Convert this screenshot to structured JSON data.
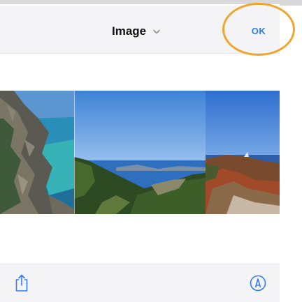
{
  "header": {
    "title": "Image",
    "ok_label": "OK"
  },
  "icons": {
    "title_chevron": "chevron-down-icon",
    "share": "share-icon",
    "markup": "markup-icon"
  },
  "colors": {
    "accent": "#2f7cf6",
    "highlight_ring": "#f0a52c",
    "bar_background": "#f4f4f6"
  },
  "photos": [
    {
      "name": "rocky-coast-photo"
    },
    {
      "name": "bay-view-photo"
    },
    {
      "name": "coastal-shrub-photo"
    }
  ]
}
